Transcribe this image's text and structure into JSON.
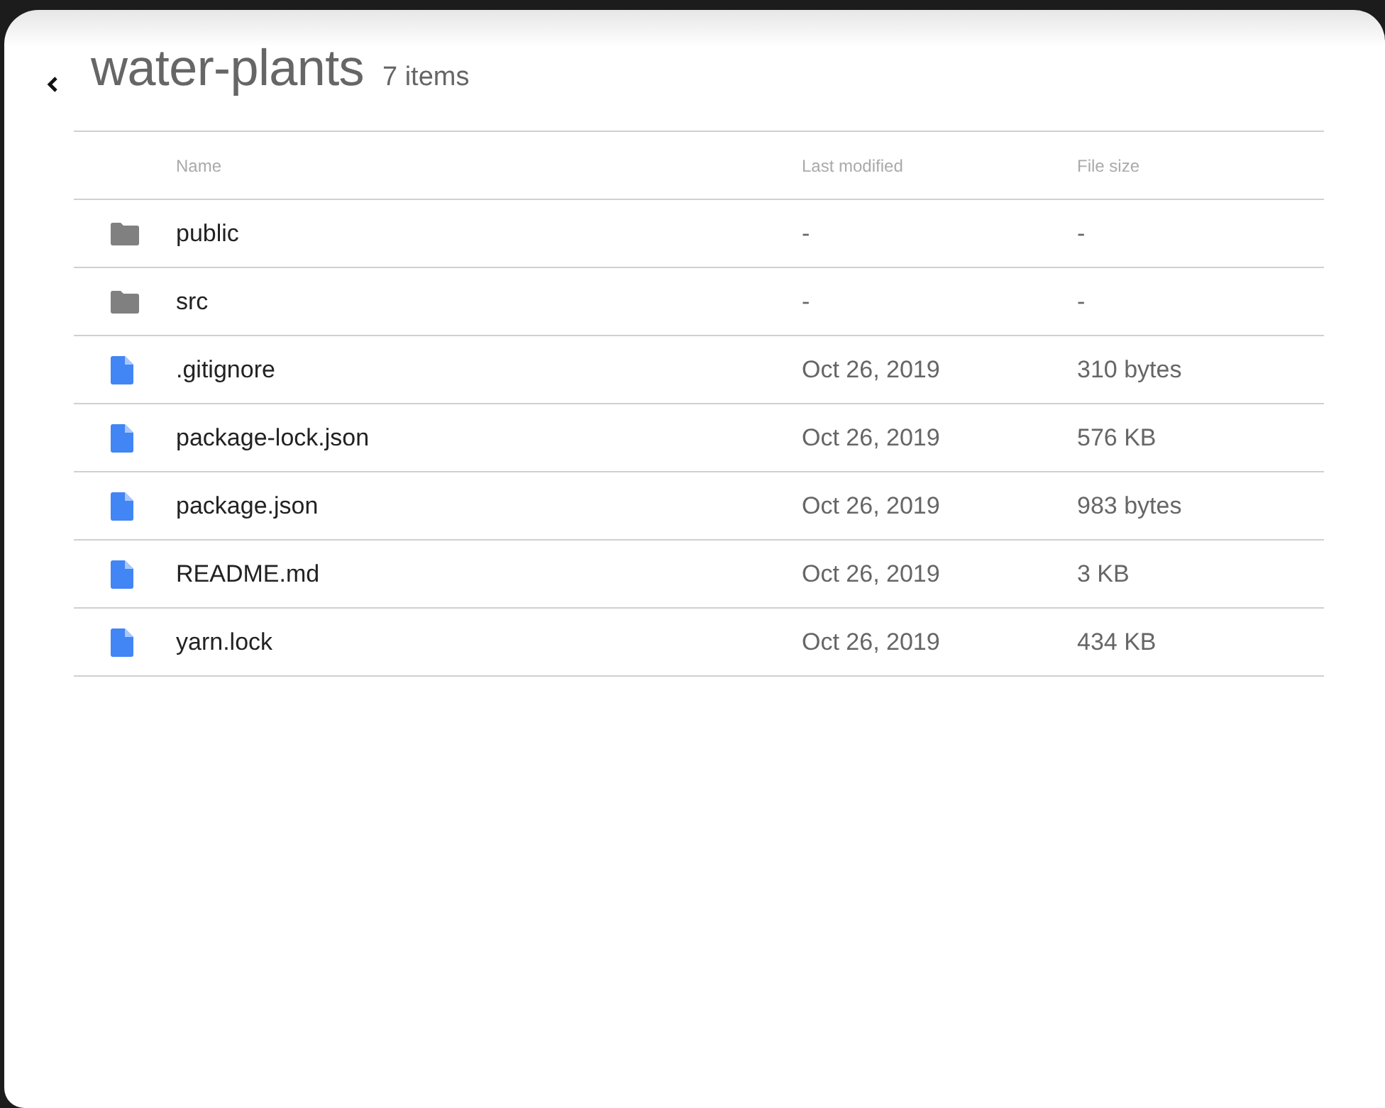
{
  "header": {
    "title": "water-plants",
    "count": "7 items"
  },
  "table": {
    "columns": [
      "Name",
      "Last modified",
      "File size"
    ],
    "rows": [
      {
        "kind": "folder",
        "name": "public",
        "modified": "-",
        "size": "-"
      },
      {
        "kind": "folder",
        "name": "src",
        "modified": "-",
        "size": "-"
      },
      {
        "kind": "file",
        "name": ".gitignore",
        "modified": "Oct 26, 2019",
        "size": "310 bytes"
      },
      {
        "kind": "file",
        "name": "package-lock.json",
        "modified": "Oct 26, 2019",
        "size": "576 KB"
      },
      {
        "kind": "file",
        "name": "package.json",
        "modified": "Oct 26, 2019",
        "size": "983 bytes"
      },
      {
        "kind": "file",
        "name": "README.md",
        "modified": "Oct 26, 2019",
        "size": "3 KB"
      },
      {
        "kind": "file",
        "name": "yarn.lock",
        "modified": "Oct 26, 2019",
        "size": "434 KB"
      }
    ]
  }
}
